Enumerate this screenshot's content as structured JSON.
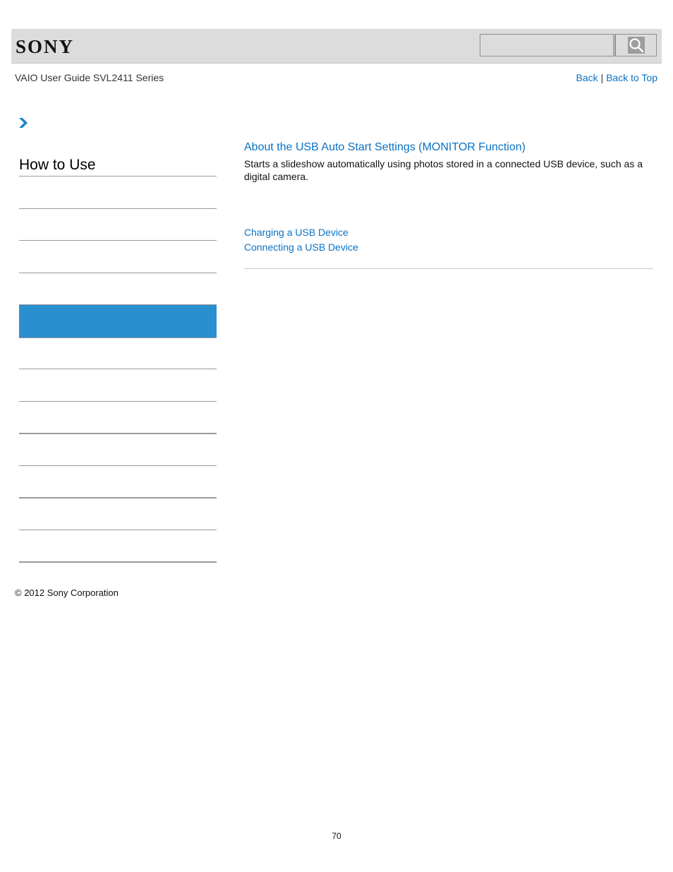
{
  "header": {
    "logo_text": "SONY",
    "search_placeholder": "",
    "search_icon": "magnifier-icon"
  },
  "guide_title": "VAIO User Guide SVL2411 Series",
  "nav_links": {
    "back": "Back",
    "separator": "|",
    "back_to_top": "Back to Top"
  },
  "breadcrumb_icon": "chevron-right-icon",
  "sidebar": {
    "title": "How to Use",
    "items": [
      {
        "label": ""
      },
      {
        "label": ""
      },
      {
        "label": ""
      },
      {
        "label": "",
        "active": true
      },
      {
        "label": ""
      },
      {
        "label": ""
      },
      {
        "label": ""
      },
      {
        "label": ""
      },
      {
        "label": ""
      },
      {
        "label": ""
      },
      {
        "label": ""
      }
    ],
    "active_color": "#2a8fce"
  },
  "main": {
    "article": {
      "title": "About the USB Auto Start Settings (MONITOR Function)",
      "description": "Starts a slideshow automatically using photos stored in a connected USB device, such as a digital camera."
    },
    "related_links": [
      "Charging a USB Device",
      "Connecting a USB Device"
    ]
  },
  "footer": {
    "copyright": "© 2012 Sony Corporation",
    "page_number": "70"
  },
  "colors": {
    "link": "#0a72c4",
    "header_bg": "#dcdcdc"
  }
}
